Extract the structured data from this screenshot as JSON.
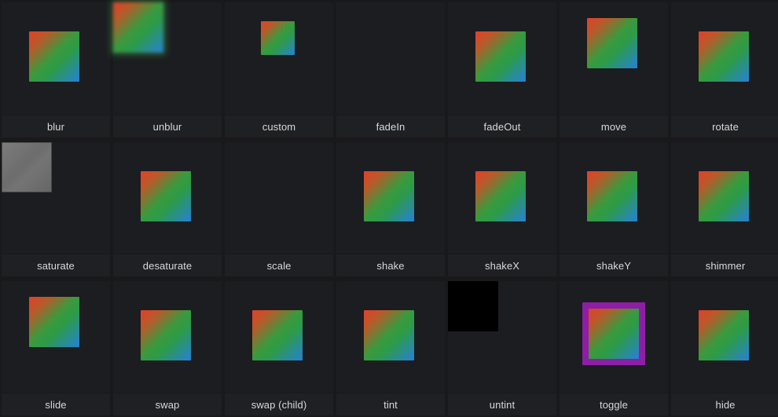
{
  "cells": [
    {
      "id": "blur",
      "label": "blur",
      "variant": "std"
    },
    {
      "id": "unblur",
      "label": "unblur",
      "variant": "blurred"
    },
    {
      "id": "custom",
      "label": "custom",
      "variant": "small"
    },
    {
      "id": "fadein",
      "label": "fadeIn",
      "variant": "hidden"
    },
    {
      "id": "fadeout",
      "label": "fadeOut",
      "variant": "std"
    },
    {
      "id": "move",
      "label": "move",
      "variant": "up"
    },
    {
      "id": "rotate",
      "label": "rotate",
      "variant": "std"
    },
    {
      "id": "saturate",
      "label": "saturate",
      "variant": "gray"
    },
    {
      "id": "desaturate",
      "label": "desaturate",
      "variant": "std"
    },
    {
      "id": "scale",
      "label": "scale",
      "variant": "hidden"
    },
    {
      "id": "shake",
      "label": "shake",
      "variant": "std"
    },
    {
      "id": "shakex",
      "label": "shakeX",
      "variant": "std"
    },
    {
      "id": "shakey",
      "label": "shakeY",
      "variant": "std"
    },
    {
      "id": "shimmer",
      "label": "shimmer",
      "variant": "std"
    },
    {
      "id": "slide",
      "label": "slide",
      "variant": "up"
    },
    {
      "id": "swap",
      "label": "swap",
      "variant": "std"
    },
    {
      "id": "swap-child",
      "label": "swap (child)",
      "variant": "std"
    },
    {
      "id": "tint",
      "label": "tint",
      "variant": "std"
    },
    {
      "id": "untint",
      "label": "untint",
      "variant": "black"
    },
    {
      "id": "toggle",
      "label": "toggle",
      "variant": "bordered"
    },
    {
      "id": "hide",
      "label": "hide",
      "variant": "std"
    }
  ],
  "colors": {
    "background": "#19191b",
    "cell": "#1c1d20",
    "label_text": "#d8d8db",
    "toggle_border": "#8e1ea6",
    "gradient": [
      "#e1402c",
      "#3a9a3e",
      "#2680d8"
    ]
  }
}
